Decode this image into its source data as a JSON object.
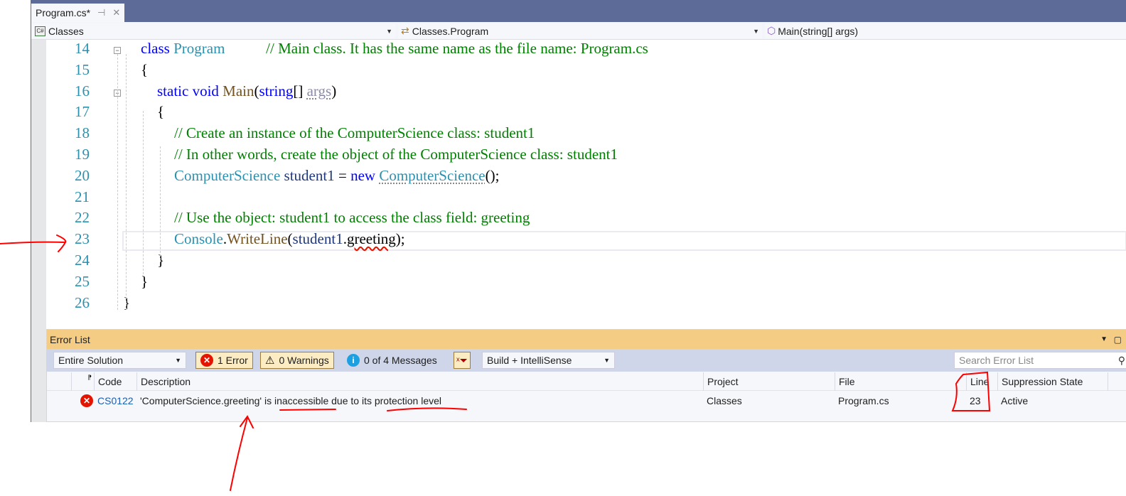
{
  "tab": {
    "title": "Program.cs*",
    "pin_icon": "pin-icon",
    "close_icon": "close-icon"
  },
  "nav": {
    "project": "Classes",
    "class": "Classes.Program",
    "member": "Main(string[] args)"
  },
  "code": {
    "line_numbers": [
      "14",
      "15",
      "16",
      "17",
      "18",
      "19",
      "20",
      "21",
      "22",
      "23",
      "24",
      "25",
      "26"
    ],
    "lines": [
      [
        {
          "t": "class",
          "c": "kw"
        },
        {
          "t": " "
        },
        {
          "t": "Program",
          "c": "ty"
        },
        {
          "t": "           "
        },
        {
          "t": "// Main class. It has the same name as the file name: Program.cs",
          "c": "cm"
        }
      ],
      [
        {
          "t": "{"
        }
      ],
      [
        {
          "t": "static",
          "c": "kw"
        },
        {
          "t": " "
        },
        {
          "t": "void",
          "c": "kw"
        },
        {
          "t": " "
        },
        {
          "t": "Main",
          "c": "me"
        },
        {
          "t": "("
        },
        {
          "t": "string",
          "c": "kw"
        },
        {
          "t": "[] "
        },
        {
          "t": "args",
          "c": "dim dots"
        },
        {
          "t": ")"
        }
      ],
      [
        {
          "t": "{"
        }
      ],
      [
        {
          "t": "// Create an instance of the ComputerScience class: student1",
          "c": "cm"
        }
      ],
      [
        {
          "t": "// In other words, create the object of the ComputerScience class: student1",
          "c": "cm"
        }
      ],
      [
        {
          "t": "ComputerScience",
          "c": "ty"
        },
        {
          "t": " "
        },
        {
          "t": "student1",
          "c": "va"
        },
        {
          "t": " = "
        },
        {
          "t": "new",
          "c": "kw"
        },
        {
          "t": " "
        },
        {
          "t": "ComputerScience",
          "c": "ty dots"
        },
        {
          "t": "();"
        }
      ],
      [],
      [
        {
          "t": "// Use the object: student1 to access the class field: greeting",
          "c": "cm"
        }
      ],
      [
        {
          "t": "Console",
          "c": "ty"
        },
        {
          "t": "."
        },
        {
          "t": "WriteLine",
          "c": "me"
        },
        {
          "t": "("
        },
        {
          "t": "student1",
          "c": "va"
        },
        {
          "t": "."
        },
        {
          "t": "greeting",
          "c": "pl squig"
        },
        {
          "t": ");"
        }
      ],
      [
        {
          "t": "}"
        }
      ],
      [
        {
          "t": "}"
        }
      ],
      [
        {
          "t": "}"
        }
      ]
    ]
  },
  "error_list": {
    "title": "Error List",
    "scope": "Entire Solution",
    "errors_label": "1 Error",
    "warnings_label": "0 Warnings",
    "messages_label": "0 of 4 Messages",
    "source": "Build + IntelliSense",
    "search_placeholder": "Search Error List",
    "columns": [
      "Code",
      "Description",
      "Project",
      "File",
      "Line",
      "Suppression State"
    ],
    "rows": [
      {
        "code": "CS0122",
        "description": "'ComputerScience.greeting' is inaccessible due to its protection level",
        "project": "Classes",
        "file": "Program.cs",
        "line": "23",
        "suppression": "Active",
        "severity": "error"
      }
    ]
  },
  "colors": {
    "keyword": "#0000ff",
    "type": "#2b91af",
    "comment": "#008000",
    "method": "#74531f",
    "annotation": "#ff0000",
    "error_list_title": "#f5cc84"
  }
}
